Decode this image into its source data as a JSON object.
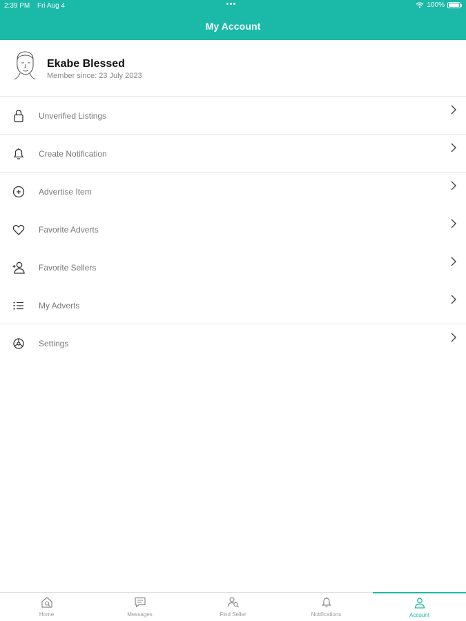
{
  "status_bar": {
    "time": "2:39 PM",
    "date": "Fri Aug 4",
    "battery": "100%"
  },
  "header": {
    "title": "My Account"
  },
  "profile": {
    "name": "Ekabe Blessed",
    "member_since": "Member since: 23 July 2023"
  },
  "menu": {
    "items": [
      {
        "label": "Unverified Listings",
        "icon": "lock-icon"
      },
      {
        "label": "Create Notification",
        "icon": "bell-icon"
      },
      {
        "label": "Advertise Item",
        "icon": "plus-circle-icon"
      },
      {
        "label": "Favorite Adverts",
        "icon": "heart-icon"
      },
      {
        "label": "Favorite Sellers",
        "icon": "user-plus-icon"
      },
      {
        "label": "My Adverts",
        "icon": "list-icon"
      },
      {
        "label": "Settings",
        "icon": "settings-icon"
      }
    ]
  },
  "tabbar": {
    "tabs": [
      {
        "label": "Home",
        "icon": "home-search-icon"
      },
      {
        "label": "Messages",
        "icon": "message-icon"
      },
      {
        "label": "Find Seller",
        "icon": "find-seller-icon"
      },
      {
        "label": "Notifications",
        "icon": "bell-icon"
      },
      {
        "label": "Account",
        "icon": "user-icon"
      }
    ],
    "active": "Account"
  },
  "colors": {
    "accent": "#1ab9a8",
    "text_muted": "#777777",
    "divider": "#e4e4e4"
  }
}
